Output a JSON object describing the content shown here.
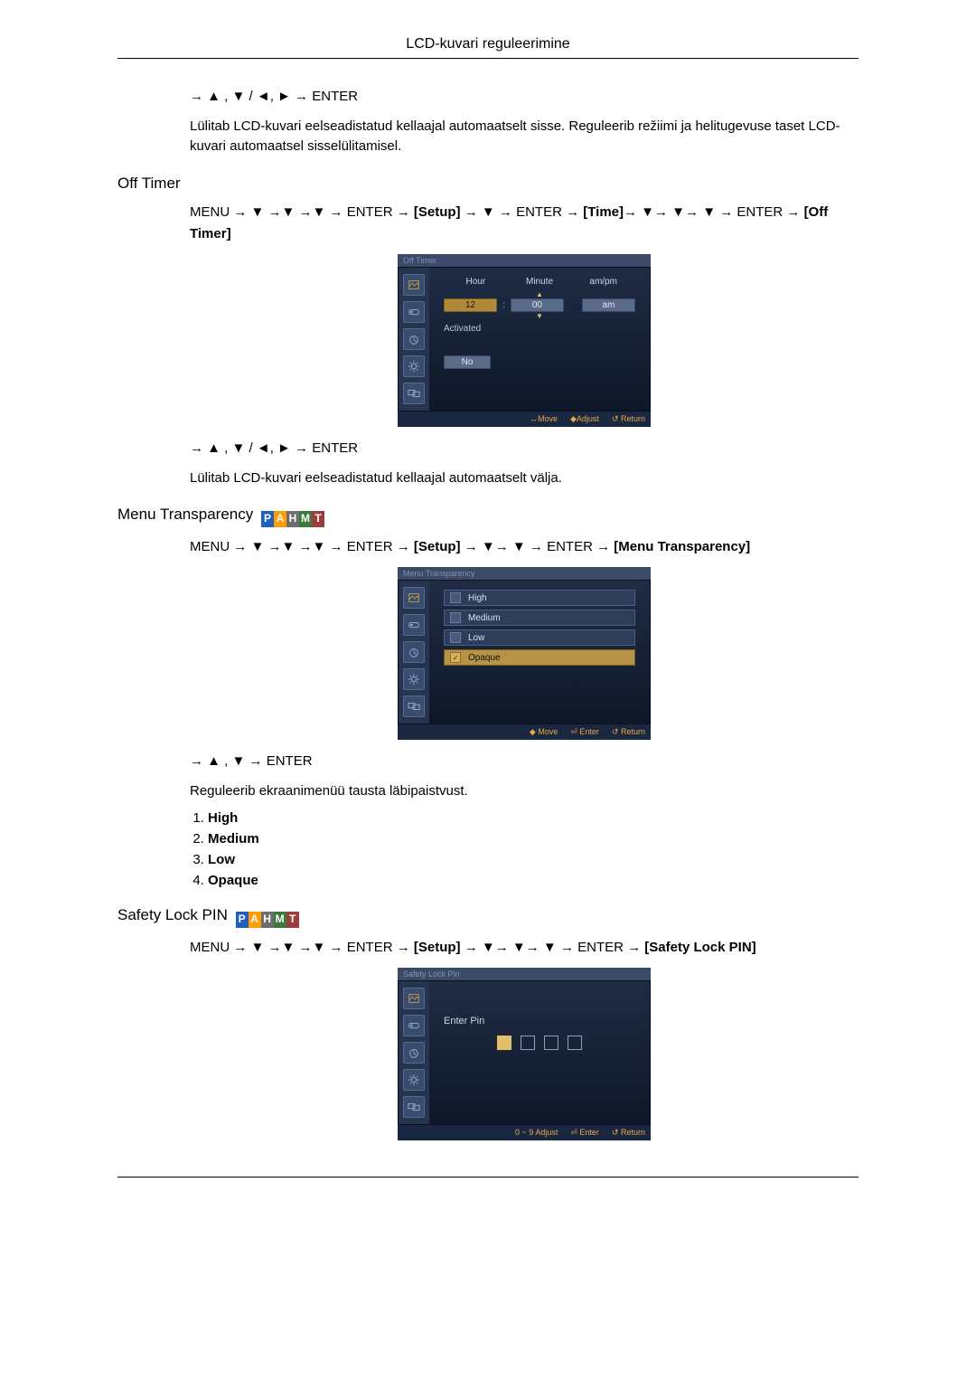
{
  "header": {
    "title": "LCD-kuvari reguleerimine"
  },
  "preamble": {
    "nav": "→ ▲ , ▼ / ◄, ► → ENTER",
    "text": "Lülitab LCD-kuvari eelseadistatud kellaajal automaatselt sisse. Reguleerib režiimi ja helitugevuse taset LCD-kuvari automaatsel sisselülitamisel."
  },
  "sections": {
    "offTimer": {
      "title": "Off Timer",
      "nav1a": "MENU → ▼ →▼ →▼ → ENTER → ",
      "nav1_setup": "[Setup]",
      "nav1b": " → ▼ → ENTER → ",
      "nav1_time": "[Time]",
      "nav1c": "→ ▼→ ▼→ ▼ → ENTER → ",
      "nav1_ot": "[Off Timer]",
      "osd": {
        "title": "Off Timer",
        "hour": "Hour",
        "minute": "Minute",
        "ampm": "am/pm",
        "hourVal": "12",
        "minuteVal": "00",
        "ampmVal": "am",
        "activated": "Activated",
        "activatedVal": "No",
        "footMove": "Move",
        "footAdjust": "Adjust",
        "footReturn": "Return"
      },
      "nav2": "→ ▲ , ▼ / ◄, ► → ENTER",
      "text": "Lülitab LCD-kuvari eelseadistatud kellaajal automaatselt välja."
    },
    "menuTransparency": {
      "title": "Menu Transparency",
      "nav1a": "MENU → ▼ →▼ →▼ → ENTER → ",
      "nav1_setup": "[Setup]",
      "nav1b": " → ▼→ ▼ → ENTER → ",
      "nav1_mt": "[Menu Transparency]",
      "osd": {
        "title": "Menu Transparency",
        "items": [
          "High",
          "Medium",
          "Low",
          "Opaque"
        ],
        "selectedIndex": 3,
        "footMove": "Move",
        "footEnter": "Enter",
        "footReturn": "Return"
      },
      "nav2": "→ ▲ , ▼ → ENTER",
      "text": "Reguleerib ekraanimenüü tausta läbipaistvust.",
      "list": [
        "High",
        "Medium",
        "Low",
        "Opaque"
      ]
    },
    "safetyLock": {
      "title": "Safety Lock PIN",
      "nav1a": "MENU → ▼ →▼ →▼ → ENTER → ",
      "nav1_setup": "[Setup]",
      "nav1b": " → ▼→ ▼→ ▼ → ENTER → ",
      "nav1_sl": "[Safety Lock PIN]",
      "osd": {
        "title": "Safety Lock Pin",
        "enterPin": "Enter  Pin",
        "footAdjust": "0 ~ 9 Adjust",
        "footEnter": "Enter",
        "footReturn": "Return"
      }
    }
  },
  "badges": [
    "P",
    "A",
    "H",
    "M",
    "T"
  ],
  "icons": {
    "move": "❖",
    "lr": "↔",
    "updown": "◆",
    "enter": "⏎",
    "return": "↺"
  }
}
